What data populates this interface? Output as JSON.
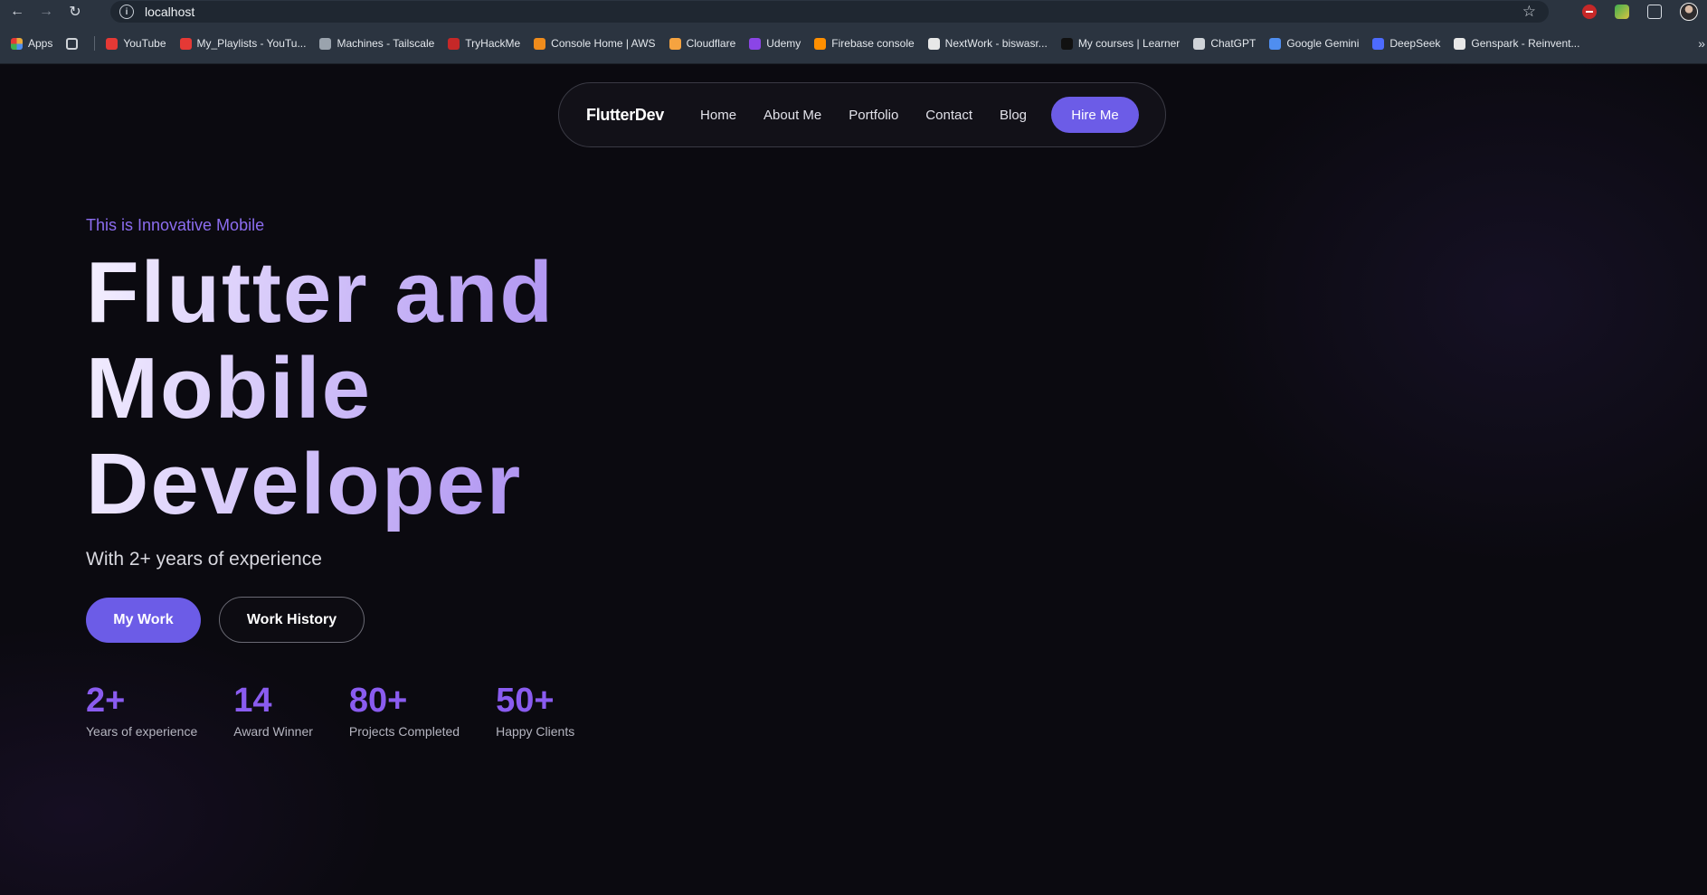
{
  "browser": {
    "url": "localhost",
    "bookmarks": [
      {
        "label": "Apps",
        "color": "#e8a93a"
      },
      {
        "label": "YouTube",
        "color": "#e53935"
      },
      {
        "label": "My_Playlists - YouTu...",
        "color": "#e53935"
      },
      {
        "label": "Machines - Tailscale",
        "color": "#9aa3ad"
      },
      {
        "label": "TryHackMe",
        "color": "#c62828"
      },
      {
        "label": "Console Home | AWS",
        "color": "#f08c1c"
      },
      {
        "label": "Cloudflare",
        "color": "#f5a340"
      },
      {
        "label": "Udemy",
        "color": "#8b45e6"
      },
      {
        "label": "Firebase console",
        "color": "#ff8f00"
      },
      {
        "label": "NextWork - biswasr...",
        "color": "#e8e8e8"
      },
      {
        "label": "My courses | Learner",
        "color": "#111111"
      },
      {
        "label": "ChatGPT",
        "color": "#cfd3d8"
      },
      {
        "label": "Google Gemini",
        "color": "#4f8ef0"
      },
      {
        "label": "DeepSeek",
        "color": "#4d6bfe"
      },
      {
        "label": "Genspark - Reinvent...",
        "color": "#e8e8e8"
      }
    ]
  },
  "nav": {
    "brand": "FlutterDev",
    "links": [
      "Home",
      "About Me",
      "Portfolio",
      "Contact",
      "Blog"
    ],
    "cta": "Hire Me"
  },
  "hero": {
    "tagline": "This is Innovative Mobile",
    "headline_lines": [
      "Flutter and",
      "Mobile",
      "Developer"
    ],
    "subtitle": "With 2+ years of experience",
    "primary_button": "My Work",
    "secondary_button": "Work History"
  },
  "stats": [
    {
      "value": "2+",
      "label": "Years of experience"
    },
    {
      "value": "14",
      "label": "Award Winner"
    },
    {
      "value": "80+",
      "label": "Projects Completed"
    },
    {
      "value": "50+",
      "label": "Happy Clients"
    }
  ],
  "colors": {
    "accent": "#6c5ce7",
    "stat": "#8a5cf0",
    "background": "#0b0a10"
  }
}
